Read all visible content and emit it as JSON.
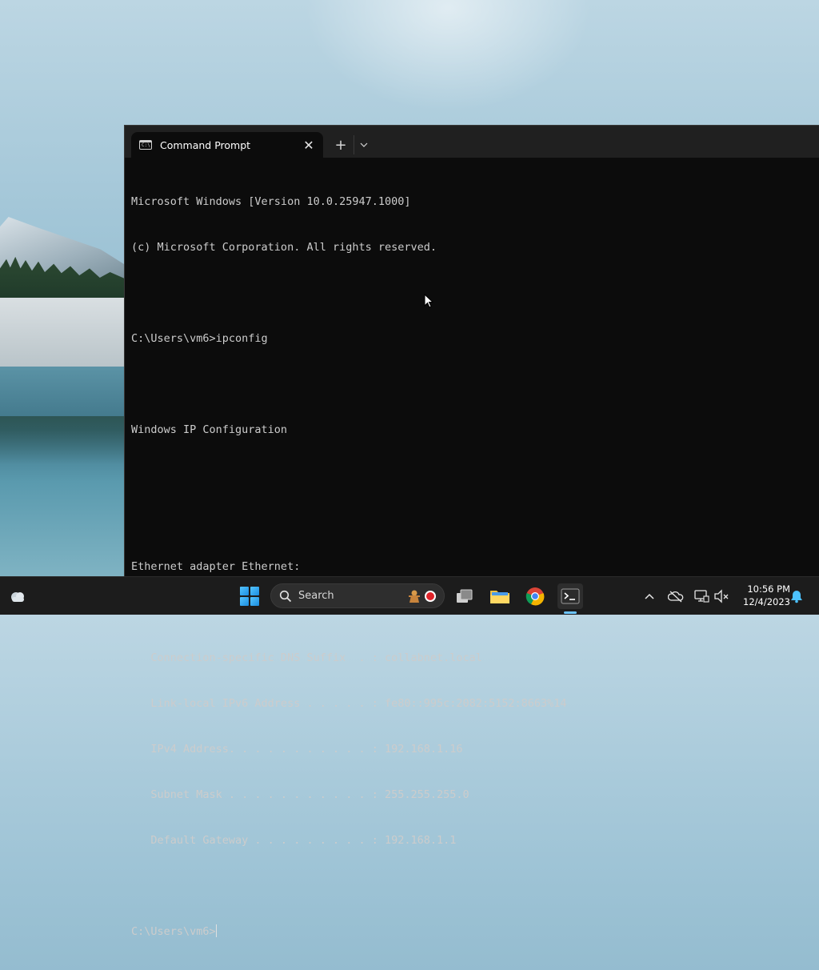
{
  "window": {
    "tab_title": "Command Prompt",
    "tab_icon_text": "C:\\",
    "close_glyph": "✕",
    "new_tab_glyph": "+",
    "dropdown_glyph": "⌄"
  },
  "console": {
    "lines": [
      "Microsoft Windows [Version 10.0.25947.1000]",
      "(c) Microsoft Corporation. All rights reserved.",
      "",
      "C:\\Users\\vm6>ipconfig",
      "",
      "Windows IP Configuration",
      "",
      "",
      "Ethernet adapter Ethernet:",
      "",
      "   Connection-specific DNS Suffix  . : collabnet.local",
      "   Link-local IPv6 Address . . . . . : fe80::995c:2082:5152:8663%14",
      "   IPv4 Address. . . . . . . . . . . : 192.168.1.16",
      "   Subnet Mask . . . . . . . . . . . : 255.255.255.0",
      "   Default Gateway . . . . . . . . . : 192.168.1.1",
      ""
    ],
    "prompt": "C:\\Users\\vm6>"
  },
  "taskbar": {
    "search_label": "Search",
    "search_badge": "🧑",
    "tray_chevron": "^",
    "time": "10:56 PM",
    "date": "12/4/2023"
  },
  "colors": {
    "console_bg": "#0c0c0c",
    "console_text": "#cccccc",
    "titlebar_bg": "#202020",
    "taskbar_bg": "#1c1c1c",
    "accent": "#6bc4ff"
  },
  "icons": {
    "tab": "cmd-icon",
    "weather": "weather-cloud-icon",
    "start": "windows-start-icon",
    "taskview": "task-view-icon",
    "explorer": "file-explorer-icon",
    "chrome": "chrome-icon",
    "terminal": "terminal-icon",
    "network": "network-icon",
    "volume": "volume-muted-icon",
    "notifications": "bell-icon"
  }
}
